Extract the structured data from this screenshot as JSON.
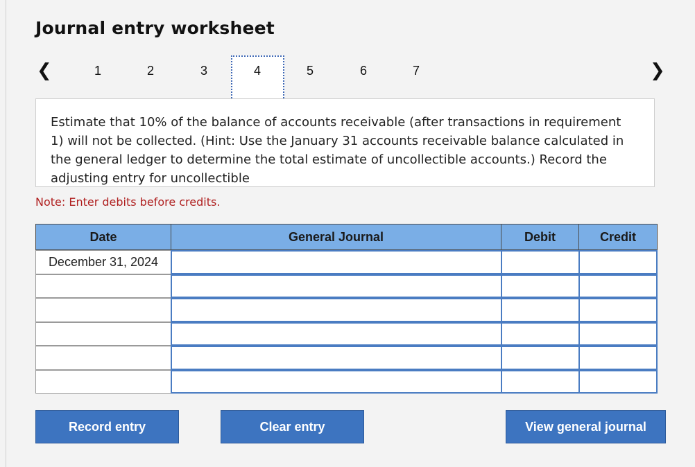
{
  "title": "Journal entry worksheet",
  "nav": {
    "prev_icon": "chevron-left-icon",
    "next_icon": "chevron-right-icon",
    "steps": [
      "1",
      "2",
      "3",
      "4",
      "5",
      "6",
      "7"
    ],
    "active_step": "4"
  },
  "prompt": "Estimate that 10% of the balance of accounts receivable (after transactions in requirement 1) will not be collected. (Hint: Use the January 31 accounts receivable balance calculated in the general ledger to determine the total estimate of uncollectible accounts.) Record the adjusting entry for uncollectible",
  "note": "Note: Enter debits before credits.",
  "table": {
    "headers": {
      "date": "Date",
      "journal": "General Journal",
      "debit": "Debit",
      "credit": "Credit"
    },
    "rows": [
      {
        "date": "December 31, 2024",
        "account": "",
        "debit": "",
        "credit": ""
      },
      {
        "date": "",
        "account": "",
        "debit": "",
        "credit": ""
      },
      {
        "date": "",
        "account": "",
        "debit": "",
        "credit": ""
      },
      {
        "date": "",
        "account": "",
        "debit": "",
        "credit": ""
      },
      {
        "date": "",
        "account": "",
        "debit": "",
        "credit": ""
      },
      {
        "date": "",
        "account": "",
        "debit": "",
        "credit": ""
      }
    ]
  },
  "buttons": {
    "record": "Record entry",
    "clear": "Clear entry",
    "view": "View general journal"
  },
  "colors": {
    "header_bg": "#7aaee6",
    "button_bg": "#3d74c0",
    "note": "#b02020",
    "input_border": "#4a7cc2"
  }
}
